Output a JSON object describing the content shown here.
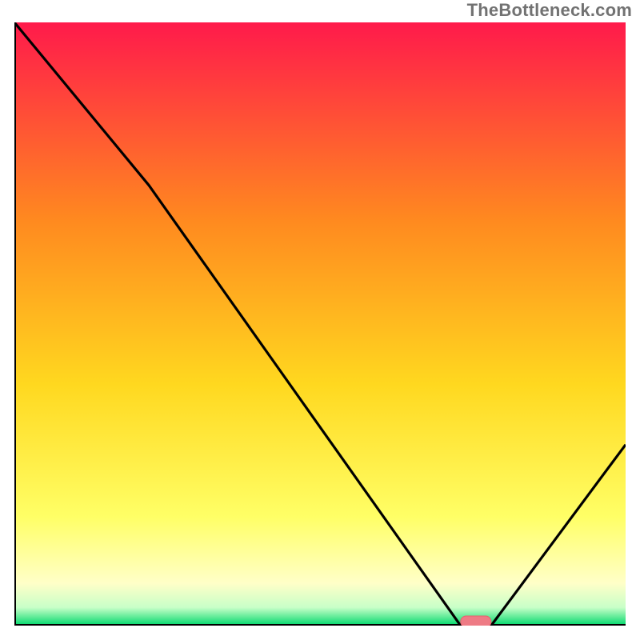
{
  "watermark": "TheBottleneck.com",
  "chart_data": {
    "type": "line",
    "title": "",
    "xlabel": "",
    "ylabel": "",
    "xlim": [
      0,
      100
    ],
    "ylim": [
      0,
      100
    ],
    "x": [
      0,
      22,
      73,
      78,
      100
    ],
    "values": [
      100,
      73,
      0,
      0,
      30
    ],
    "marker": {
      "x_start": 73,
      "x_end": 78,
      "y": 0
    },
    "gradient_stops": [
      {
        "offset": 0.0,
        "color": "#ff1a4b"
      },
      {
        "offset": 0.33,
        "color": "#ff8a1f"
      },
      {
        "offset": 0.6,
        "color": "#ffd81f"
      },
      {
        "offset": 0.82,
        "color": "#ffff66"
      },
      {
        "offset": 0.93,
        "color": "#ffffc8"
      },
      {
        "offset": 0.97,
        "color": "#c8ffc8"
      },
      {
        "offset": 1.0,
        "color": "#00d86b"
      }
    ],
    "axis_color": "#000000",
    "line_color": "#000000",
    "marker_fill": "#ee7b85",
    "marker_stroke": "#e8606d"
  }
}
